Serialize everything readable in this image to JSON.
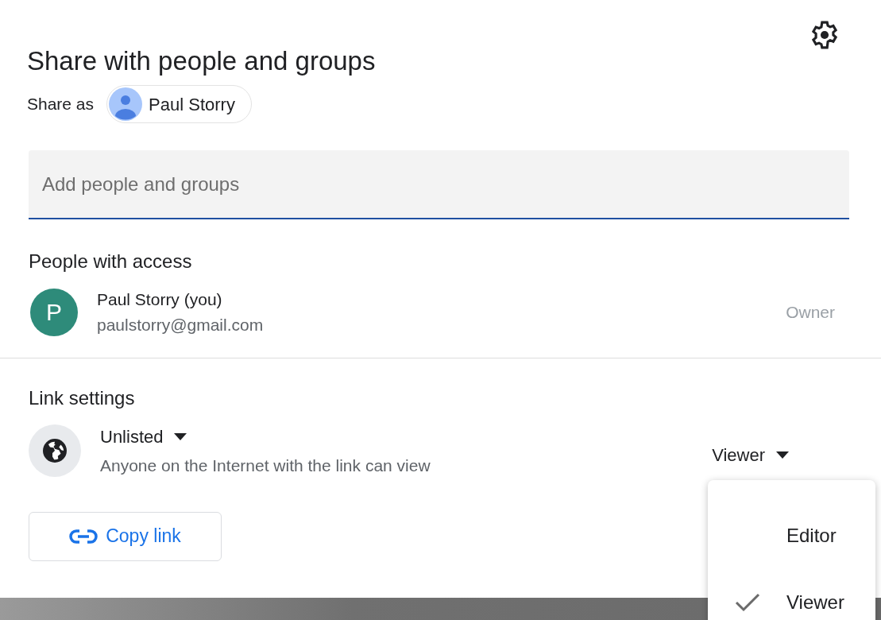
{
  "dialog": {
    "title": "Share with people and groups",
    "share_as": {
      "label": "Share as",
      "name": "Paul Storry"
    },
    "add_field": {
      "placeholder": "Add people and groups"
    },
    "people_section": {
      "heading": "People with access",
      "people": [
        {
          "initial": "P",
          "name": "Paul Storry (you)",
          "email": "paulstorry@gmail.com",
          "role": "Owner"
        }
      ]
    },
    "link_settings": {
      "heading": "Link settings",
      "access": "Unlisted",
      "description": "Anyone on the Internet with the link can view",
      "role": "Viewer"
    },
    "copy_link_button": "Copy link"
  },
  "role_menu": {
    "items": [
      {
        "label": "Editor",
        "selected": false
      },
      {
        "label": "Viewer",
        "selected": true
      }
    ]
  }
}
